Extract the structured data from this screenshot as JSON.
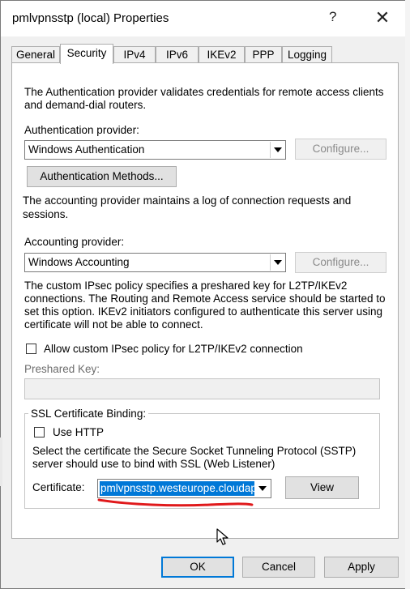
{
  "window": {
    "title": "pmlvpnsstp (local) Properties",
    "help_glyph": "?",
    "close_glyph": "✕"
  },
  "tabs": [
    {
      "label": "General",
      "active": false
    },
    {
      "label": "Security",
      "active": true
    },
    {
      "label": "IPv4",
      "active": false
    },
    {
      "label": "IPv6",
      "active": false
    },
    {
      "label": "IKEv2",
      "active": false
    },
    {
      "label": "PPP",
      "active": false
    },
    {
      "label": "Logging",
      "active": false
    }
  ],
  "security": {
    "auth_description_line1": "The Authentication provider validates credentials for remote access clients",
    "auth_description_line2": "and demand-dial routers.",
    "auth_provider_label": "Authentication provider:",
    "auth_provider_value": "Windows Authentication",
    "auth_configure_label": "Configure...",
    "auth_methods_label": "Authentication Methods...",
    "acct_description_line1": "The accounting provider maintains a log of connection requests and",
    "acct_description_line2": "sessions.",
    "acct_provider_label": "Accounting provider:",
    "acct_provider_value": "Windows Accounting",
    "acct_configure_label": "Configure...",
    "ipsec_description_lines": [
      "The custom IPsec policy specifies a preshared key for L2TP/IKEv2",
      "connections. The Routing and Remote Access service should be started to",
      "set this option. IKEv2 initiators configured to authenticate this server using",
      "certificate will not be able to connect."
    ],
    "ipsec_checkbox_label": "Allow custom IPsec policy for L2TP/IKEv2 connection",
    "ipsec_checked": false,
    "preshared_key_label": "Preshared Key:",
    "preshared_key_value": "",
    "ssl_group_label": "SSL Certificate Binding:",
    "use_http_label": "Use HTTP",
    "use_http_checked": false,
    "sstp_description_line1": "Select the certificate the Secure Socket Tunneling Protocol (SSTP)",
    "sstp_description_line2": "server should use to bind with SSL (Web Listener)",
    "certificate_label": "Certificate:",
    "certificate_value": "pmlvpnsstp.westeurope.cloudap",
    "view_label": "View"
  },
  "footer": {
    "ok_label": "OK",
    "cancel_label": "Cancel",
    "apply_label": "Apply"
  },
  "colors": {
    "accent": "#0078d7",
    "annotation_underline": "#e0191b"
  }
}
